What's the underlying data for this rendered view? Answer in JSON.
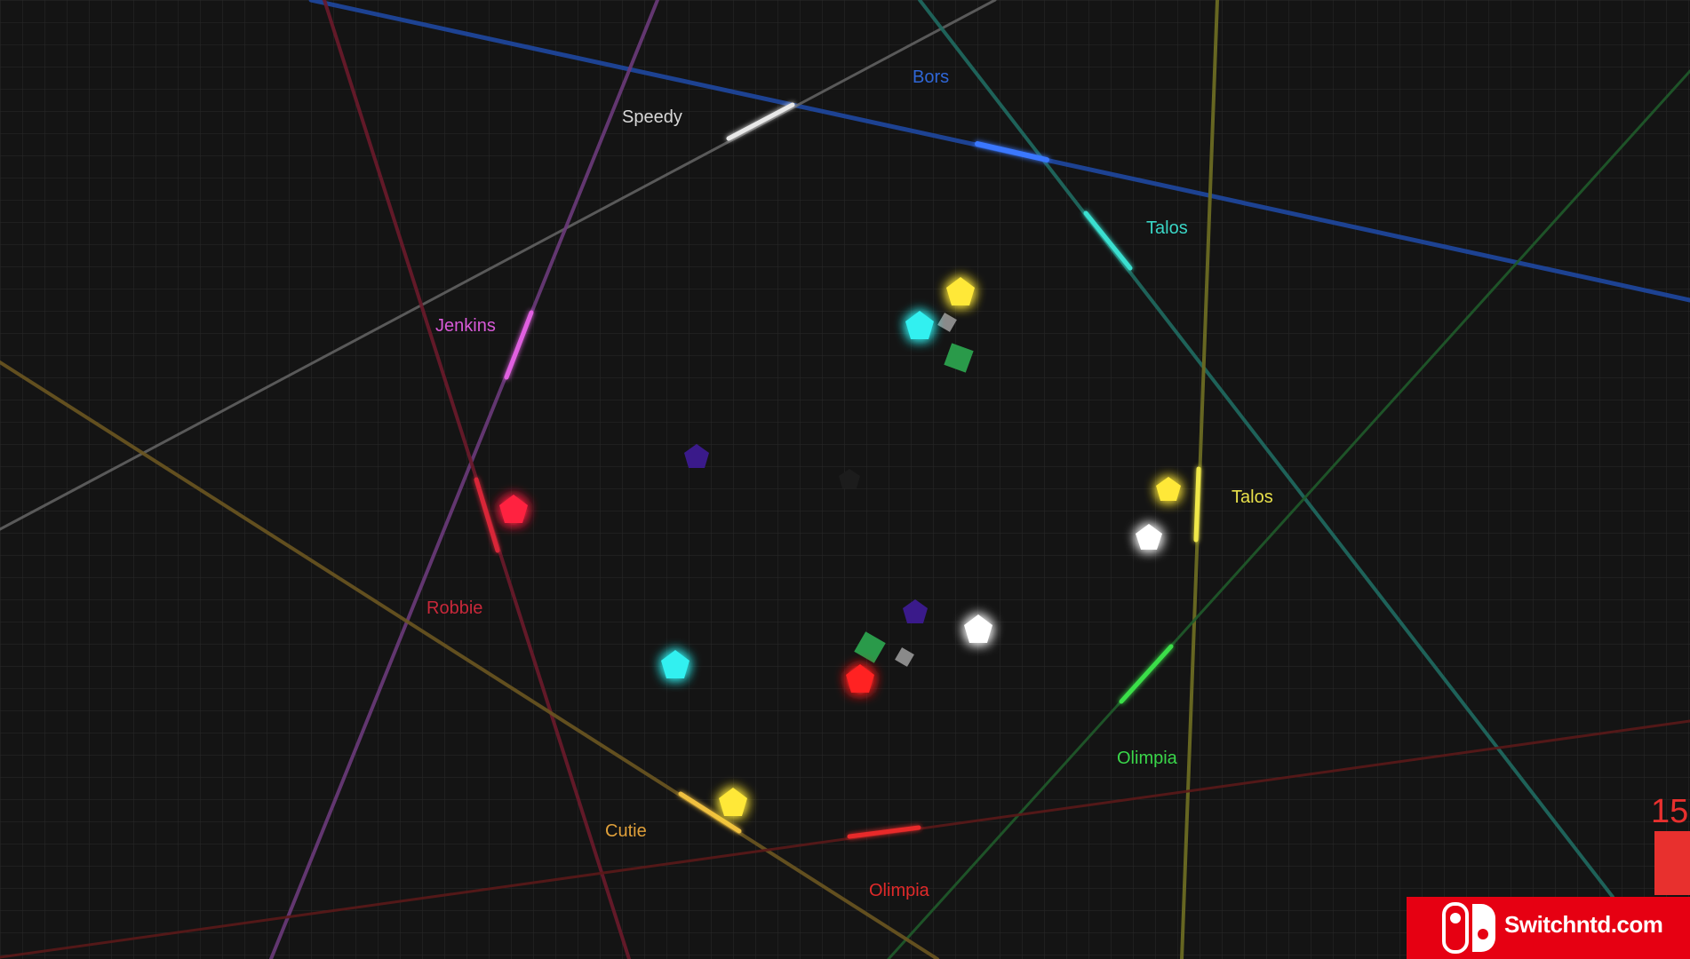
{
  "players": [
    {
      "name": "Bors",
      "color": "#2f66d6"
    },
    {
      "name": "Speedy",
      "color": "#d8d8d8"
    },
    {
      "name": "Talos",
      "color": "#3ad6c6"
    },
    {
      "name": "Jenkins",
      "color": "#d85ad8"
    },
    {
      "name": "Talos",
      "color": "#e8e04a"
    },
    {
      "name": "Robbie",
      "color": "#c8283a"
    },
    {
      "name": "Olimpia",
      "color": "#3ad64a"
    },
    {
      "name": "Cutie",
      "color": "#e0a03a"
    },
    {
      "name": "Olimpia",
      "color": "#e02a2a"
    }
  ],
  "hud": {
    "score": "15",
    "score_color": "#e8302e"
  },
  "watermark": {
    "text": "Switchntd.com",
    "color": "#e60012"
  }
}
